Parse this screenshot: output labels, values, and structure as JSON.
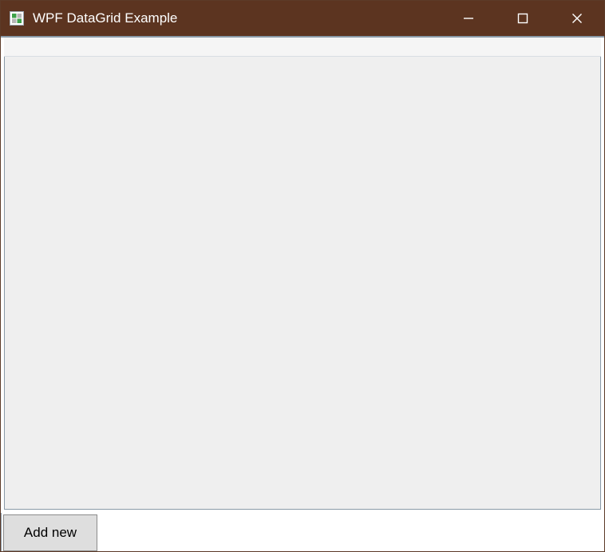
{
  "window": {
    "title": "WPF DataGrid Example"
  },
  "footer": {
    "add_new_label": "Add new"
  }
}
